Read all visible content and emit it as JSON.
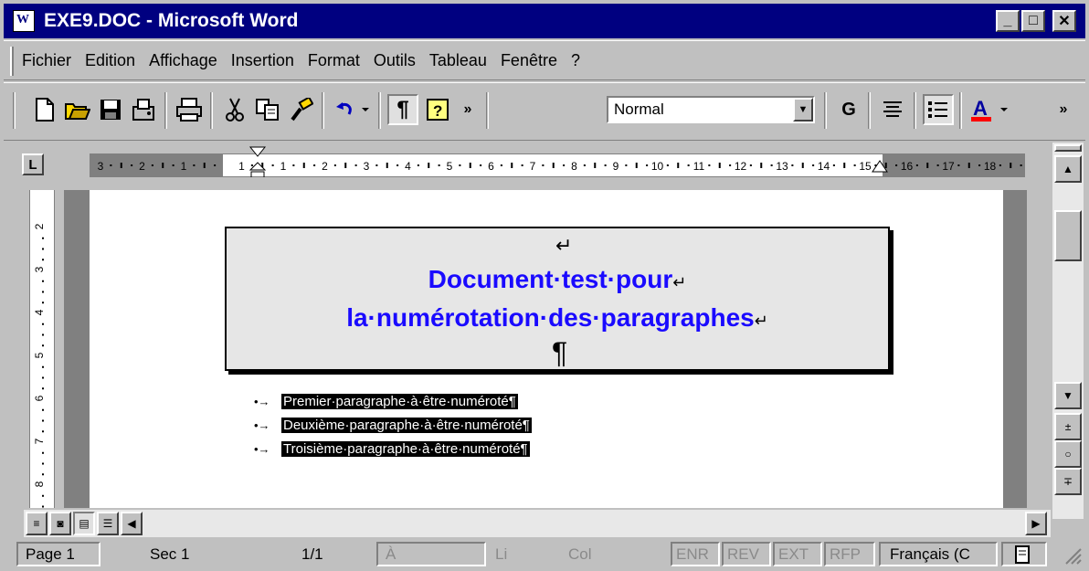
{
  "window": {
    "title": "EXE9.DOC - Microsoft Word",
    "minimize": "_",
    "maximize": "□",
    "close": "✕"
  },
  "menu": [
    "Fichier",
    "Edition",
    "Affichage",
    "Insertion",
    "Format",
    "Outils",
    "Tableau",
    "Fenêtre",
    "?"
  ],
  "toolbar": {
    "style_value": "Normal",
    "bold_label": "G",
    "more": "»"
  },
  "document": {
    "return_mark": "↵",
    "heading_line1": "Document·test·pour",
    "heading_line2": "la·numérotation·des·paragraphes",
    "pilcrow": "¶",
    "bullets": [
      "Premier·paragraphe·à·être·numéroté¶",
      "Deuxième·paragraphe·à·être·numéroté¶",
      "Troisième·paragraphe·à·être·numéroté¶"
    ]
  },
  "ruler": {
    "h_labels": [
      "3",
      "2",
      "1",
      "1",
      "1",
      "2",
      "3",
      "4",
      "5",
      "6",
      "7",
      "8",
      "9",
      "10",
      "11",
      "12",
      "13",
      "14",
      "15",
      "16",
      "17",
      "18"
    ],
    "v_labels": [
      "2",
      "3",
      "4",
      "5",
      "6",
      "7",
      "8"
    ]
  },
  "status": {
    "page": "Page 1",
    "section": "Sec 1",
    "pages": "1/1",
    "at": "À",
    "line": "Li",
    "col": "Col",
    "enr": "ENR",
    "rev": "REV",
    "ext": "EXT",
    "rfp": "RFP",
    "language": "Français (C"
  },
  "colors": {
    "titlebar": "#000080",
    "heading": "#1a0aff",
    "chrome": "#c0c0c0",
    "font_color_bar": "#ff0000"
  },
  "icons": [
    "new-icon",
    "open-icon",
    "save-icon",
    "fax-icon",
    "print-icon",
    "cut-icon",
    "copy-icon",
    "format-painter-icon",
    "undo-icon",
    "show-marks-icon",
    "help-icon",
    "align-center-icon",
    "bullets-icon",
    "font-color-icon"
  ]
}
